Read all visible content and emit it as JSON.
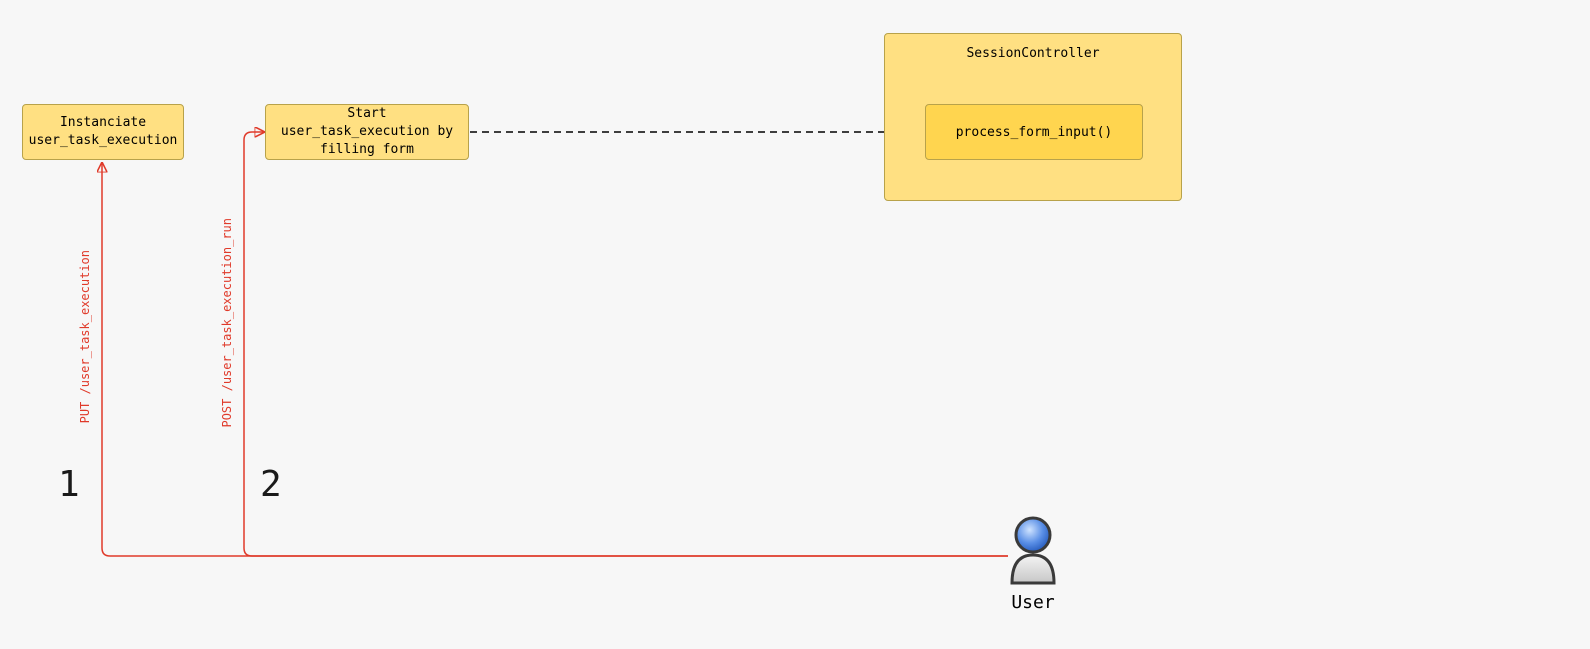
{
  "nodes": {
    "instanciate": {
      "line1": "Instanciate",
      "line2": "user_task_execution"
    },
    "start": {
      "line1": "Start user_task_execution by",
      "line2": "filling form"
    },
    "controller": {
      "title": "SessionController",
      "inner": "process_form_input()"
    }
  },
  "edges": {
    "e1_label": "PUT /user_task_execution",
    "e2_label": "POST /user_task_execution_run"
  },
  "numbers": {
    "one": "1",
    "two": "2"
  },
  "actor": {
    "label": "User"
  },
  "colors": {
    "node_fill": "#ffe082",
    "node_border": "#b8a24a",
    "inner_fill": "#ffd54f",
    "arrow_red": "#e03a2a",
    "arrow_black": "#000000",
    "bg": "#f7f7f7"
  }
}
